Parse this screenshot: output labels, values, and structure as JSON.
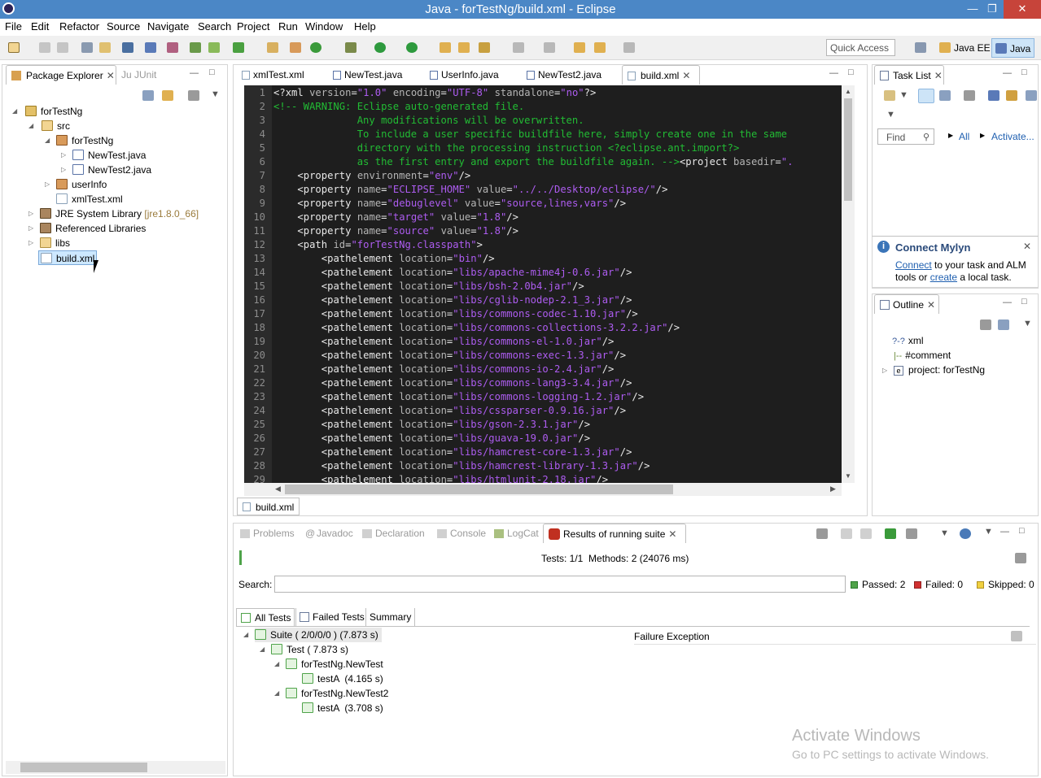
{
  "window": {
    "title": "Java - forTestNg/build.xml - Eclipse"
  },
  "menu": [
    "File",
    "Edit",
    "Refactor",
    "Source",
    "Navigate",
    "Search",
    "Project",
    "Run",
    "Window",
    "Help"
  ],
  "quick_access": "Quick Access",
  "perspectives": [
    "Java EE",
    "Java"
  ],
  "package_explorer": {
    "tabs": [
      "Package Explorer",
      "JUnit"
    ],
    "tree": [
      "forTestNg",
      "src",
      "forTestNg",
      "NewTest.java",
      "NewTest2.java",
      "userInfo",
      "xmlTest.xml",
      "JRE System Library",
      "[jre1.8.0_66]",
      "Referenced Libraries",
      "libs",
      "build.xml"
    ]
  },
  "editor": {
    "tabs": [
      "xmlTest.xml",
      "NewTest.java",
      "UserInfo.java",
      "NewTest2.java",
      "build.xml"
    ],
    "bottom_tab": "build.xml",
    "line_numbers": [
      "1",
      "2",
      "3",
      "4",
      "5",
      "6",
      "7",
      "8",
      "9",
      "10",
      "11",
      "12",
      "13",
      "14",
      "15",
      "16",
      "17",
      "18",
      "19",
      "20",
      "21",
      "22",
      "23",
      "24",
      "25",
      "26",
      "27",
      "28",
      "29"
    ],
    "lines": [
      "<?xml version=\"1.0\" encoding=\"UTF-8\" standalone=\"no\"?>",
      "<!-- WARNING: Eclipse auto-generated file.",
      "              Any modifications will be overwritten.",
      "              To include a user specific buildfile here, simply create one in the same",
      "              directory with the processing instruction <?eclipse.ant.import?>",
      "              as the first entry and export the buildfile again. --><project basedir=\".",
      "    <property environment=\"env\"/>",
      "    <property name=\"ECLIPSE_HOME\" value=\"../../Desktop/eclipse/\"/>",
      "    <property name=\"debuglevel\" value=\"source,lines,vars\"/>",
      "    <property name=\"target\" value=\"1.8\"/>",
      "    <property name=\"source\" value=\"1.8\"/>",
      "    <path id=\"forTestNg.classpath\">",
      "        <pathelement location=\"bin\"/>",
      "        <pathelement location=\"libs/apache-mime4j-0.6.jar\"/>",
      "        <pathelement location=\"libs/bsh-2.0b4.jar\"/>",
      "        <pathelement location=\"libs/cglib-nodep-2.1_3.jar\"/>",
      "        <pathelement location=\"libs/commons-codec-1.10.jar\"/>",
      "        <pathelement location=\"libs/commons-collections-3.2.2.jar\"/>",
      "        <pathelement location=\"libs/commons-el-1.0.jar\"/>",
      "        <pathelement location=\"libs/commons-exec-1.3.jar\"/>",
      "        <pathelement location=\"libs/commons-io-2.4.jar\"/>",
      "        <pathelement location=\"libs/commons-lang3-3.4.jar\"/>",
      "        <pathelement location=\"libs/commons-logging-1.2.jar\"/>",
      "        <pathelement location=\"libs/cssparser-0.9.16.jar\"/>",
      "        <pathelement location=\"libs/gson-2.3.1.jar\"/>",
      "        <pathelement location=\"libs/guava-19.0.jar\"/>",
      "        <pathelement location=\"libs/hamcrest-core-1.3.jar\"/>",
      "        <pathelement location=\"libs/hamcrest-library-1.3.jar\"/>",
      "        <pathelement location=\"libs/htmlunit-2.18.jar\"/>"
    ]
  },
  "task_list": {
    "tab": "Task List",
    "find_placeholder": "Find",
    "all": "All",
    "activate": "Activate..."
  },
  "mylyn": {
    "title": "Connect Mylyn",
    "connect": "Connect",
    "text1": "to your task and ALM",
    "text2": "tools or",
    "create": "create",
    "text3": "a local task."
  },
  "outline": {
    "tab": "Outline",
    "items": [
      "xml",
      "#comment",
      "project: forTestNg"
    ],
    "item_icons": [
      "?-?",
      "|--",
      "e"
    ]
  },
  "bottom": {
    "tabs": [
      "Problems",
      "Javadoc",
      "Declaration",
      "Console",
      "LogCat",
      "Results of running suite"
    ],
    "summary": "Tests: 1/1  Methods: 2 (24076 ms)",
    "search_label": "Search:",
    "passed": "Passed: 2",
    "failed": "Failed: 0",
    "skipped": "Skipped: 0",
    "result_tabs": [
      "All Tests",
      "Failed Tests",
      "Summary"
    ],
    "tree": [
      "Suite ( 2/0/0/0 ) (7.873 s)",
      "Test ( 7.873 s)",
      "forTestNg.NewTest",
      "testA  (4.165 s)",
      "forTestNg.NewTest2",
      "testA  (3.708 s)"
    ],
    "failure_header": "Failure Exception"
  },
  "watermark": {
    "line1": "Activate Windows",
    "line2": "Go to PC settings to activate Windows."
  },
  "colors": {
    "titlebar": "#4b87c6",
    "editor_bg": "#1e1e1e",
    "xml_value": "#ad5cf0",
    "xml_comment": "#22bc34",
    "progress": "#4fa34a"
  }
}
